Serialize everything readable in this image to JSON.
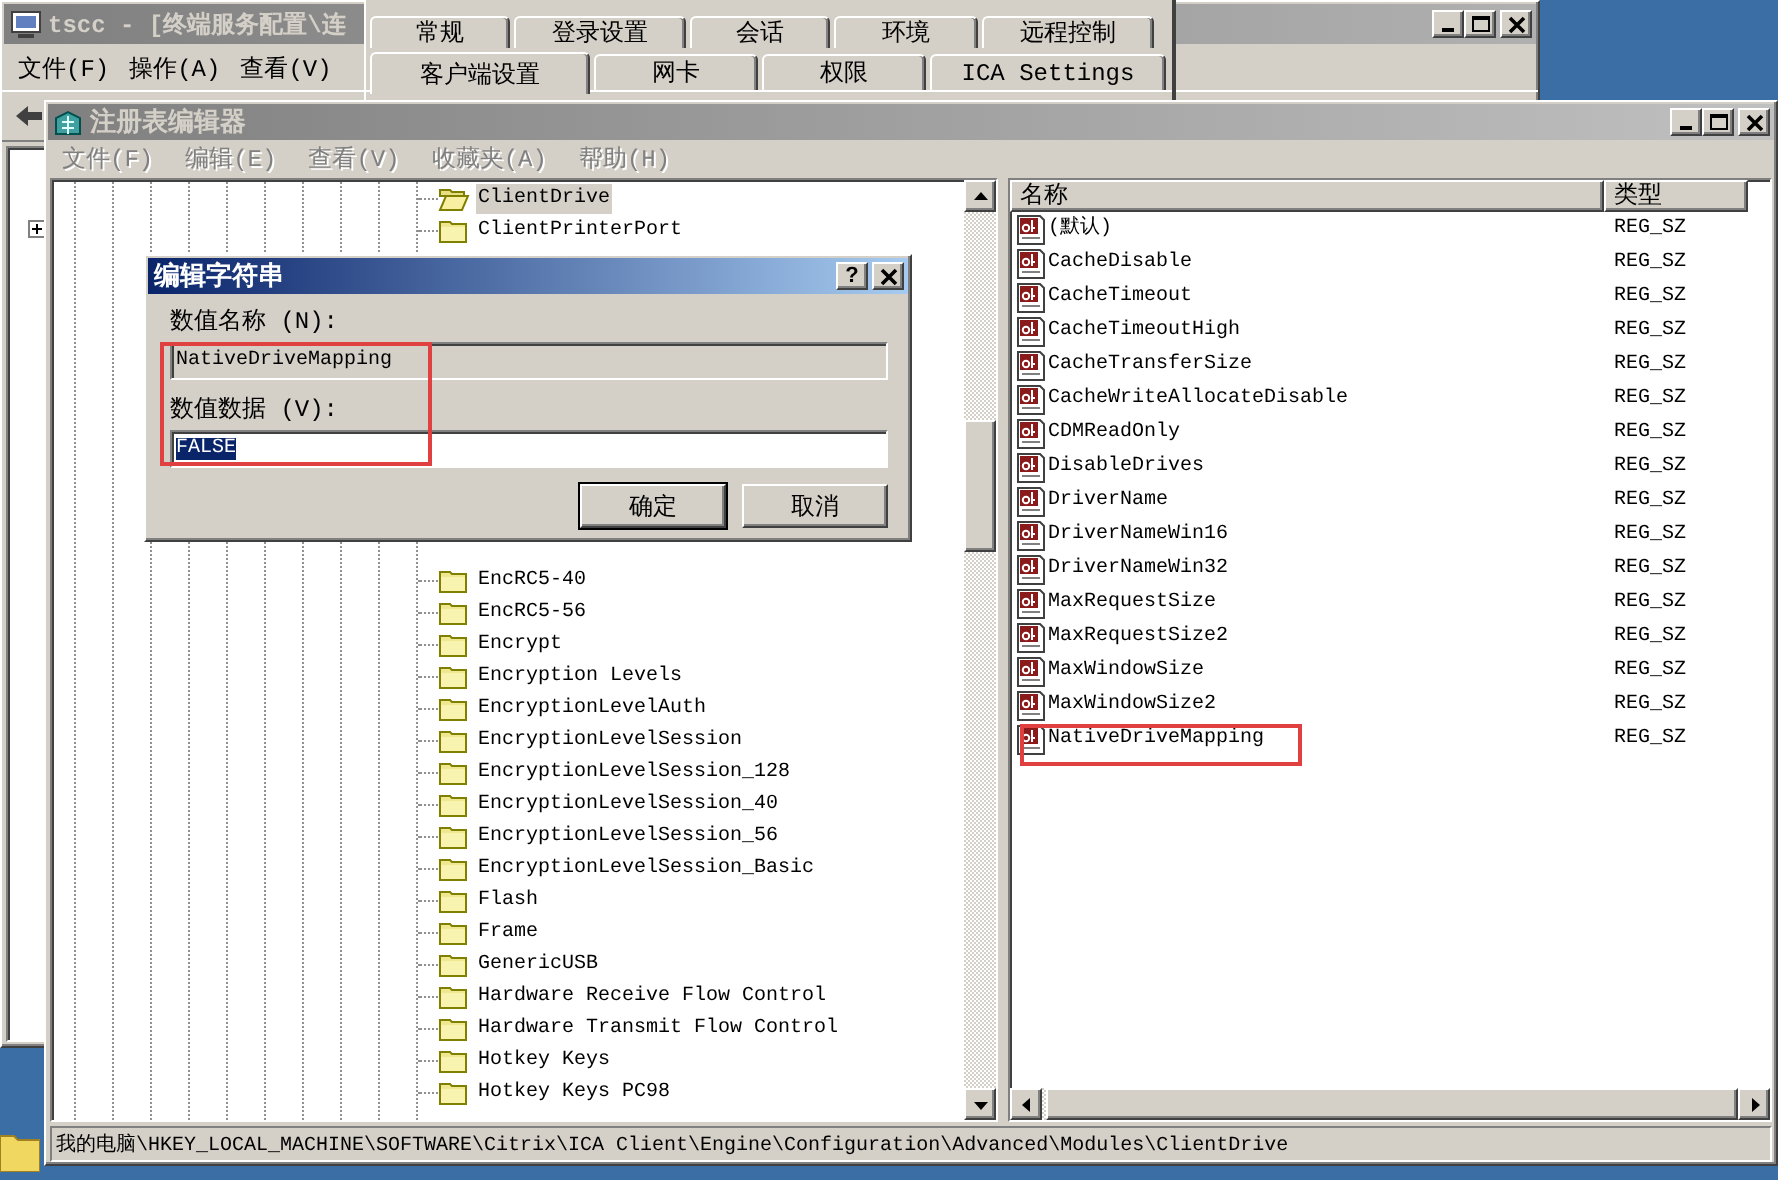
{
  "tscc_window": {
    "title": "tscc - [终端服务配置\\连",
    "menu": [
      "文件(F)",
      "操作(A)",
      "查看(V)"
    ]
  },
  "properties_dialog": {
    "tab_rows": [
      [
        {
          "label": "常规",
          "selected": false
        },
        {
          "label": "登录设置",
          "selected": false
        },
        {
          "label": "会话",
          "selected": false
        },
        {
          "label": "环境",
          "selected": false
        },
        {
          "label": "远程控制",
          "selected": false
        }
      ],
      [
        {
          "label": "客户端设置",
          "selected": true
        },
        {
          "label": "网卡",
          "selected": false
        },
        {
          "label": "权限",
          "selected": false
        },
        {
          "label": "ICA Settings",
          "selected": false
        }
      ]
    ]
  },
  "registry_editor": {
    "title": "注册表编辑器",
    "menu": [
      {
        "label": "文件(F)",
        "disabled": true
      },
      {
        "label": "编辑(E)",
        "disabled": true
      },
      {
        "label": "查看(V)",
        "disabled": true
      },
      {
        "label": "收藏夹(A)",
        "disabled": true
      },
      {
        "label": "帮助(H)",
        "disabled": true
      }
    ],
    "tree": [
      {
        "label": "ClientDrive",
        "selected": true
      },
      {
        "label": "ClientPrinterPort",
        "selected": false
      },
      {
        "label": "EncRC5-40",
        "selected": false
      },
      {
        "label": "EncRC5-56",
        "selected": false
      },
      {
        "label": "Encrypt",
        "selected": false
      },
      {
        "label": "Encryption Levels",
        "selected": false
      },
      {
        "label": "EncryptionLevelAuth",
        "selected": false
      },
      {
        "label": "EncryptionLevelSession",
        "selected": false
      },
      {
        "label": "EncryptionLevelSession_128",
        "selected": false
      },
      {
        "label": "EncryptionLevelSession_40",
        "selected": false
      },
      {
        "label": "EncryptionLevelSession_56",
        "selected": false
      },
      {
        "label": "EncryptionLevelSession_Basic",
        "selected": false
      },
      {
        "label": "Flash",
        "selected": false
      },
      {
        "label": "Frame",
        "selected": false
      },
      {
        "label": "GenericUSB",
        "selected": false
      },
      {
        "label": "Hardware Receive Flow Control",
        "selected": false
      },
      {
        "label": "Hardware Transmit Flow Control",
        "selected": false
      },
      {
        "label": "Hotkey Keys",
        "selected": false
      },
      {
        "label": "Hotkey Keys PC98",
        "selected": false
      }
    ],
    "columns": [
      "名称",
      "类型"
    ],
    "values": [
      {
        "name": "(默认)",
        "type": "REG_SZ"
      },
      {
        "name": "CacheDisable",
        "type": "REG_SZ"
      },
      {
        "name": "CacheTimeout",
        "type": "REG_SZ"
      },
      {
        "name": "CacheTimeoutHigh",
        "type": "REG_SZ"
      },
      {
        "name": "CacheTransferSize",
        "type": "REG_SZ"
      },
      {
        "name": "CacheWriteAllocateDisable",
        "type": "REG_SZ"
      },
      {
        "name": "CDMReadOnly",
        "type": "REG_SZ"
      },
      {
        "name": "DisableDrives",
        "type": "REG_SZ"
      },
      {
        "name": "DriverName",
        "type": "REG_SZ"
      },
      {
        "name": "DriverNameWin16",
        "type": "REG_SZ"
      },
      {
        "name": "DriverNameWin32",
        "type": "REG_SZ"
      },
      {
        "name": "MaxRequestSize",
        "type": "REG_SZ"
      },
      {
        "name": "MaxRequestSize2",
        "type": "REG_SZ"
      },
      {
        "name": "MaxWindowSize",
        "type": "REG_SZ"
      },
      {
        "name": "MaxWindowSize2",
        "type": "REG_SZ"
      },
      {
        "name": "NativeDriveMapping",
        "type": "REG_SZ"
      }
    ],
    "status_bar": "我的电脑\\HKEY_LOCAL_MACHINE\\SOFTWARE\\Citrix\\ICA Client\\Engine\\Configuration\\Advanced\\Modules\\ClientDrive"
  },
  "edit_dialog": {
    "title": "编辑字符串",
    "help": "?",
    "name_label": "数值名称 (N):",
    "name_value": "NativeDriveMapping",
    "data_label": "数值数据 (V):",
    "data_value": "FALSE",
    "data_value_selected": true,
    "buttons": [
      {
        "label": "确定",
        "default": true
      },
      {
        "label": "取消",
        "default": false
      }
    ]
  }
}
